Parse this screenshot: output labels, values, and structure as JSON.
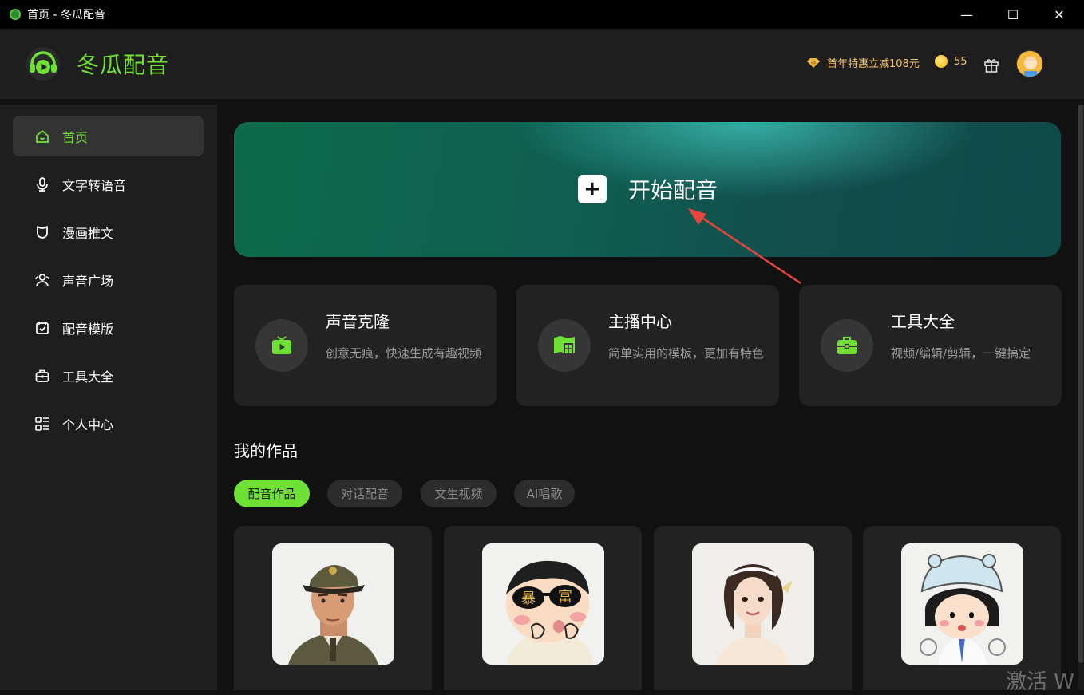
{
  "window": {
    "title": "首页 - 冬瓜配音",
    "minimize": "—",
    "maximize": "☐",
    "close": "✕"
  },
  "header": {
    "brand": "冬瓜配音",
    "promo_text": "首年特惠立减108元",
    "coins": "55",
    "icons": {
      "logo": "headphones-play-logo",
      "promo": "diamond-vip-icon",
      "coin": "coin-icon",
      "gift": "gift-icon",
      "avatar": "user-avatar"
    }
  },
  "sidebar": {
    "items": [
      {
        "label": "首页",
        "icon": "home-icon",
        "active": true
      },
      {
        "label": "文字转语音",
        "icon": "microphone-icon",
        "active": false
      },
      {
        "label": "漫画推文",
        "icon": "bear-icon",
        "active": false
      },
      {
        "label": "声音广场",
        "icon": "users-icon",
        "active": false
      },
      {
        "label": "配音模版",
        "icon": "template-check-icon",
        "active": false
      },
      {
        "label": "工具大全",
        "icon": "toolbox-icon",
        "active": false
      },
      {
        "label": "个人中心",
        "icon": "profile-list-icon",
        "active": false
      }
    ]
  },
  "banner": {
    "plus": "+",
    "cta": "开始配音"
  },
  "features": [
    {
      "title": "声音克隆",
      "desc": "创意无痕，快速生成有趣视频",
      "icon": "tv-play-icon"
    },
    {
      "title": "主播中心",
      "desc": "简单实用的模板，更加有特色",
      "icon": "building-icon"
    },
    {
      "title": "工具大全",
      "desc": "视频/编辑/剪辑，一键搞定",
      "icon": "briefcase-icon"
    }
  ],
  "works": {
    "title": "我的作品",
    "tabs": [
      "配音作品",
      "对话配音",
      "文生视频",
      "AI唱歌"
    ],
    "active_tab": 0,
    "cards": [
      {
        "thumb": "officer-avatar"
      },
      {
        "thumb": "cartoon-boy-sunglasses-avatar",
        "sunglasses_text": [
          "暴",
          "富"
        ]
      },
      {
        "thumb": "girl-avatar"
      },
      {
        "thumb": "cartoon-girl-helmet-avatar"
      }
    ]
  },
  "watermark": "激活 W",
  "colors": {
    "accent": "#6fe135",
    "promo": "#f2c36b",
    "panel": "#222222",
    "sidebar": "#1e1e1e"
  }
}
